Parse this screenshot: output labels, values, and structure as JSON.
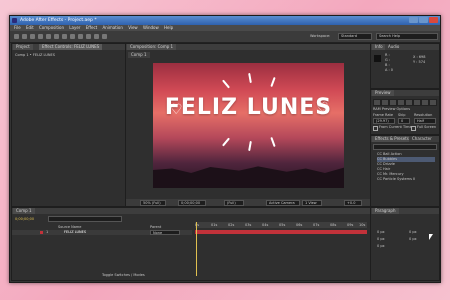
{
  "window": {
    "title": "Adobe After Effects - Project.aep *"
  },
  "menu": [
    "File",
    "Edit",
    "Composition",
    "Layer",
    "Effect",
    "Animation",
    "View",
    "Window",
    "Help"
  ],
  "toolbar": {
    "workspace_label": "Workspace:",
    "workspace_value": "Standard",
    "search_placeholder": "Search Help"
  },
  "project_panel": {
    "tabs": [
      "Project",
      "Effect Controls: FELIZ LUNES"
    ],
    "header": "Comp 1 • FELIZ LUNES"
  },
  "composition_panel": {
    "tab": "Composition: Comp 1",
    "subtab": "Comp 1",
    "frame_title": "FELIZ LUNES",
    "footer": {
      "zoom": "50% (Full)",
      "time": "0;00;00;00",
      "resolution": "(Full)",
      "camera": "Active Camera",
      "views": "1 View",
      "offset": "+0.0"
    }
  },
  "info_panel": {
    "tabs": [
      "Info",
      "Audio"
    ],
    "lines": [
      "R :",
      "G :",
      "B :",
      "A : 0"
    ],
    "right": [
      "X : 698",
      "Y : 574"
    ]
  },
  "preview_panel": {
    "title": "Preview",
    "ram_options": "RAM Preview Options",
    "frame_rate_label": "Frame Rate",
    "skip_label": "Skip",
    "resolution_label": "Resolution",
    "frame_rate": "(29.97)",
    "skip": "0",
    "resolution": "Half",
    "from_current": "From Current Time",
    "full_screen": "Full Screen"
  },
  "effects_panel": {
    "tabs": [
      "Effects & Presets",
      "Character"
    ],
    "items": [
      "CC Ball Action",
      "CC Bubbles",
      "CC Drizzle",
      "CC Hair",
      "CC Mr. Mercury",
      "CC Particle Systems II"
    ]
  },
  "timeline": {
    "tab": "Comp 1",
    "time": "0;00;00;00",
    "search_placeholder": "",
    "layer_header": "Source Name",
    "parent_header": "Parent",
    "layer_num": "1",
    "layer_name": "FELIZ LUNES",
    "layer_parent": "None",
    "ticks": [
      "0s",
      "01s",
      "02s",
      "03s",
      "04s",
      "05s",
      "06s",
      "07s",
      "08s",
      "09s",
      "10s"
    ],
    "footer": "Toggle Switches / Modes"
  },
  "paragraph_panel": {
    "title": "Paragraph",
    "vals": [
      "0 px",
      "0 px",
      "0 px",
      "0 px",
      "0 px"
    ]
  }
}
